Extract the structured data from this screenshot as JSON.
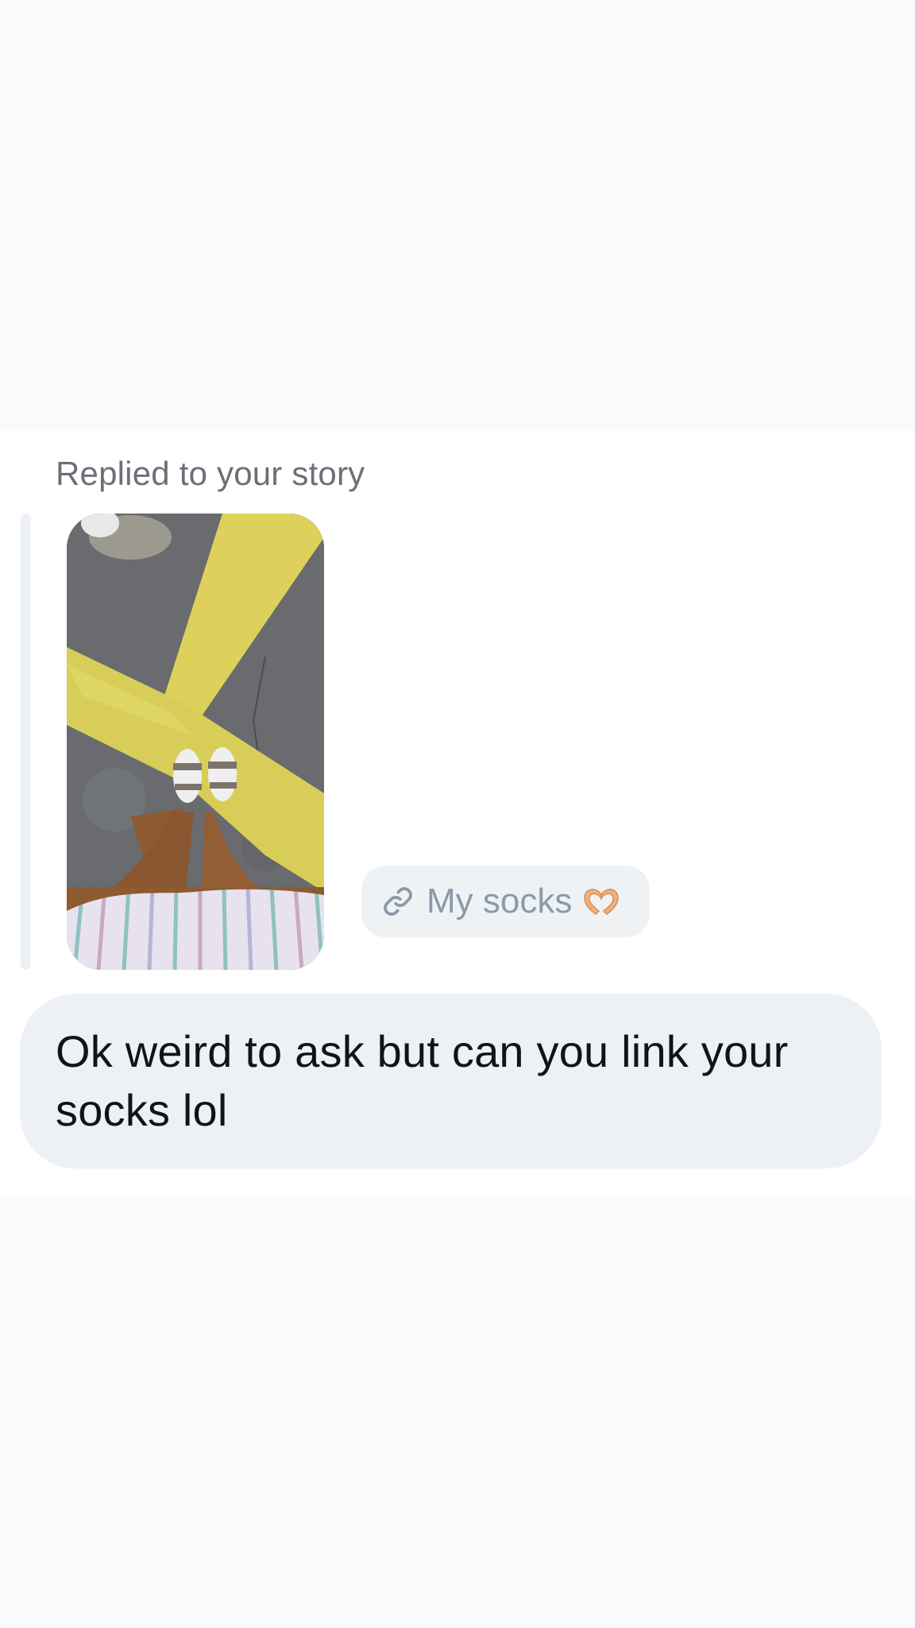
{
  "conversation": {
    "reply_context": "Replied to your story",
    "story": {
      "link_sticker": {
        "icon": "link-icon",
        "label": "My socks",
        "emoji": "heart-hands-emoji"
      }
    },
    "message": {
      "text": "Ok weird to ask but can you link your socks lol"
    }
  },
  "colors": {
    "page_background": "#f9fafc",
    "card_background": "#ffffff",
    "bubble_background": "#edf1f5",
    "chip_text": "#8a9aa9",
    "context_text": "#6b7078",
    "message_text": "#111417"
  }
}
